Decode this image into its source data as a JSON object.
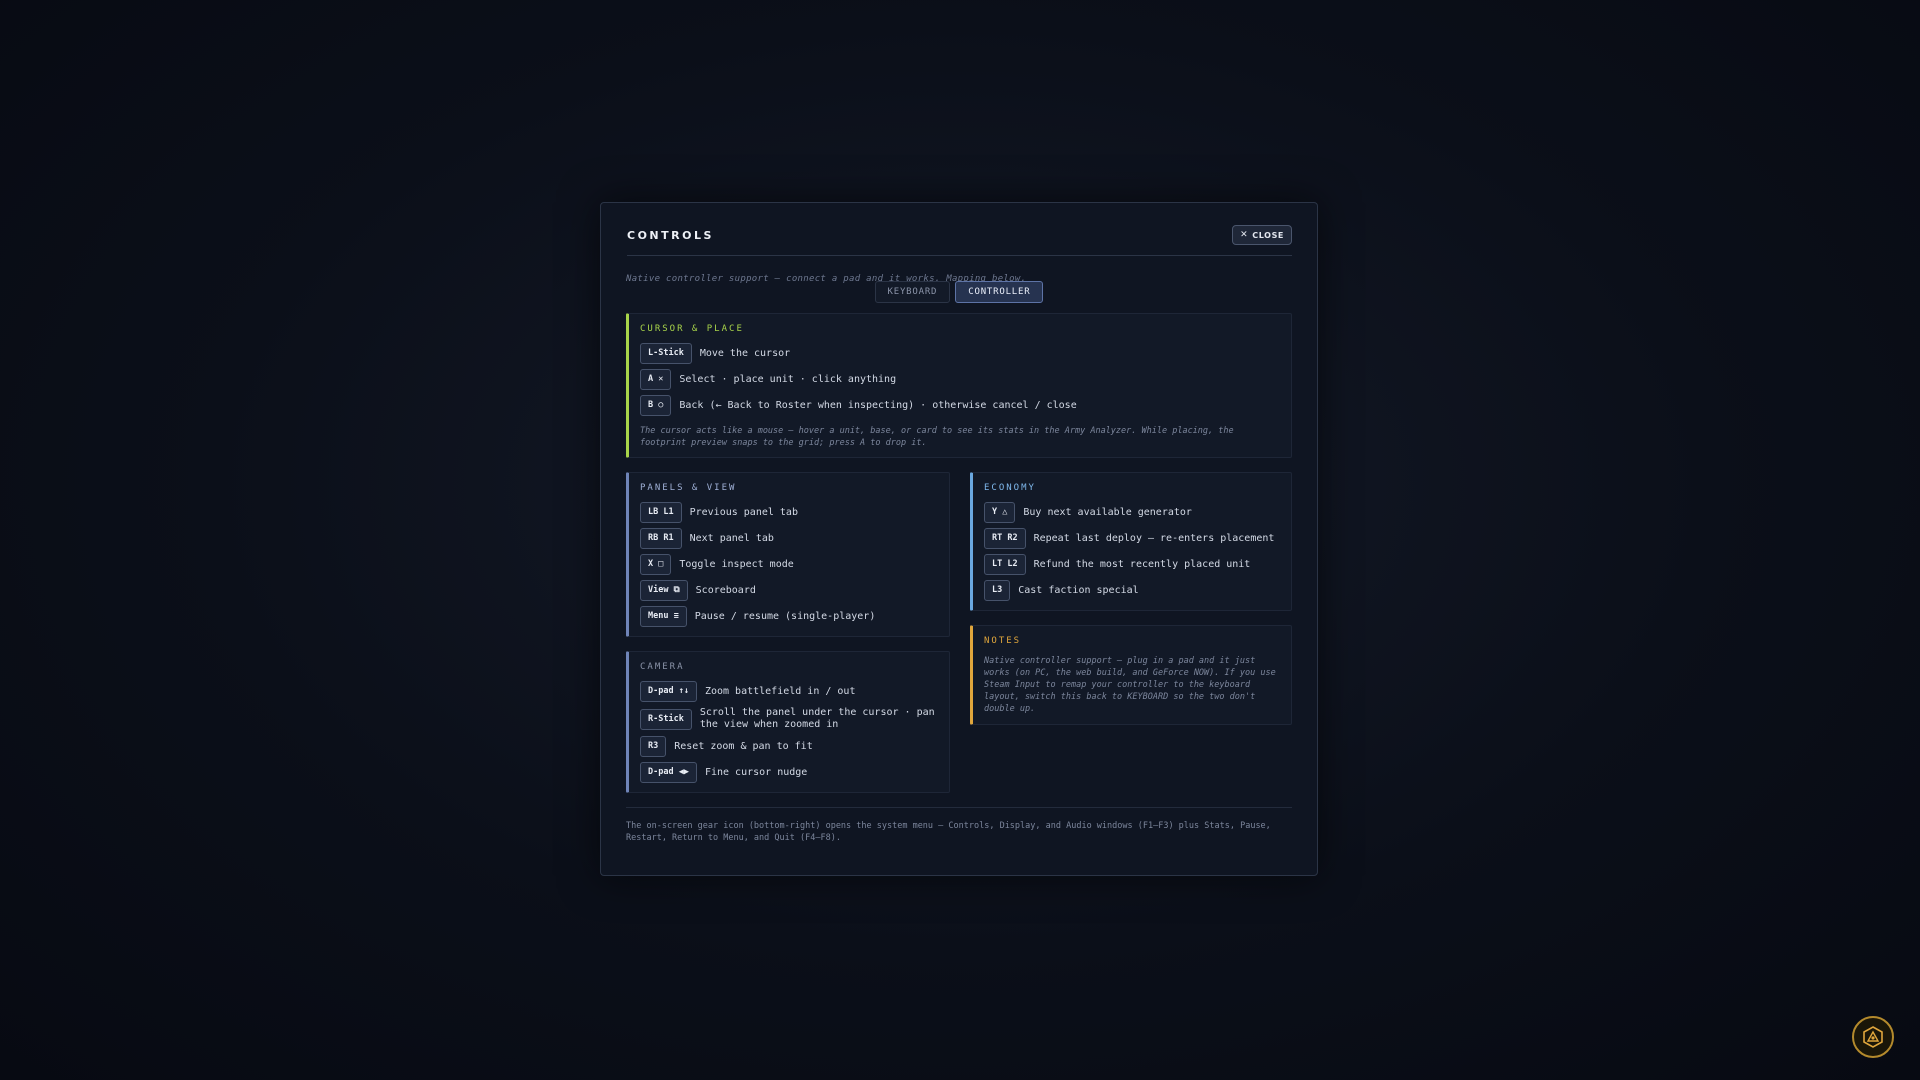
{
  "modal": {
    "title": "CONTROLS",
    "close_label": "CLOSE",
    "subtitle": "Native controller support — connect a pad and it works. Mapping below.",
    "tabs": [
      {
        "label": "KEYBOARD",
        "active": false
      },
      {
        "label": "CONTROLLER",
        "active": true
      }
    ]
  },
  "sections": {
    "cursor": {
      "title": "CURSOR & PLACE",
      "accent": "#a8d44a",
      "rows": [
        {
          "key": "L-Stick",
          "text": "Move the cursor"
        },
        {
          "key": "A ✕",
          "text": "Select · place unit · click anything"
        },
        {
          "key": "B ○",
          "text": "Back (← Back to Roster when inspecting) · otherwise cancel / close"
        }
      ],
      "note": "The cursor acts like a mouse — hover a unit, base, or card to see its stats in the Army Analyzer. While placing, the footprint preview snaps to the grid; press A to drop it."
    },
    "panels": {
      "title": "PANELS & VIEW",
      "accent": "#6f84b8",
      "rows": [
        {
          "key": "LB L1",
          "text": "Previous panel tab"
        },
        {
          "key": "RB R1",
          "text": "Next panel tab"
        },
        {
          "key": "X □",
          "text": "Toggle inspect mode"
        },
        {
          "key": "View ⧉",
          "text": "Scoreboard"
        },
        {
          "key": "Menu ≡",
          "text": "Pause / resume (single-player)"
        }
      ]
    },
    "economy": {
      "title": "ECONOMY",
      "accent": "#6aa8e0",
      "rows": [
        {
          "key": "Y △",
          "text": "Buy next available generator"
        },
        {
          "key": "RT R2",
          "text": "Repeat last deploy — re-enters placement"
        },
        {
          "key": "LT L2",
          "text": "Refund the most recently placed unit"
        },
        {
          "key": "L3",
          "text": "Cast faction special"
        }
      ]
    },
    "camera": {
      "title": "CAMERA",
      "accent": "#6f84b8",
      "rows": [
        {
          "key": "D-pad ↑↓",
          "text": "Zoom battlefield in / out"
        },
        {
          "key": "R-Stick",
          "text": "Scroll the panel under the cursor · pan the view when zoomed in"
        },
        {
          "key": "R3",
          "text": "Reset zoom & pan to fit"
        },
        {
          "key": "D-pad ◀▶",
          "text": "Fine cursor nudge"
        }
      ]
    },
    "notes": {
      "title": "NOTES",
      "accent": "#e0a63c",
      "text": "Native controller support — plug in a pad and it just works (on PC, the web build, and GeForce NOW). If you use Steam Input to remap your controller to the keyboard layout, switch this back to KEYBOARD so the two don't double up."
    }
  },
  "footer": "The on-screen gear icon (bottom-right) opens the system menu — Controls, Display, and Audio windows (F1–F3) plus Stats, Pause, Restart, Return to Menu, and Quit (F4–F8).",
  "colors": {
    "title_cursor": "#a8d44a",
    "title_panels": "#9fb0d6",
    "title_economy": "#7fb8ec",
    "title_camera": "#8a93a8",
    "title_notes": "#e0a63c",
    "gear_accent": "#b48a2c"
  }
}
